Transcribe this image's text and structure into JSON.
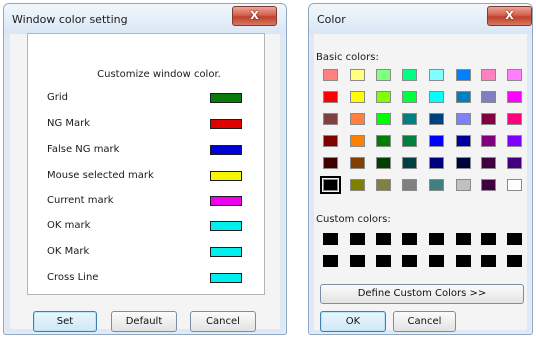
{
  "window1": {
    "title": "Window color setting",
    "close_glyph": "X",
    "heading": "Customize window color.",
    "rows": [
      {
        "label": "Grid",
        "color": "#0a7a0a"
      },
      {
        "label": "NG Mark",
        "color": "#e00000"
      },
      {
        "label": "False NG mark",
        "color": "#0000d8"
      },
      {
        "label": "Mouse selected mark",
        "color": "#f6f600"
      },
      {
        "label": "Current mark",
        "color": "#ef00ef"
      },
      {
        "label": "OK mark",
        "color": "#00f0f0"
      },
      {
        "label": "OK Mark",
        "color": "#00f0f0"
      },
      {
        "label": "Cross Line",
        "color": "#00f0f0"
      }
    ],
    "buttons": {
      "set": "Set",
      "default": "Default",
      "cancel": "Cancel"
    }
  },
  "window2": {
    "title": "Color",
    "close_glyph": "X",
    "basic_colors_label": "Basic colors:",
    "custom_colors_label": "Custom colors:",
    "basic_colors": [
      "#ff8080",
      "#ffff80",
      "#80ff80",
      "#00ff80",
      "#80ffff",
      "#0080ff",
      "#ff80c0",
      "#ff80ff",
      "#ff0000",
      "#ffff00",
      "#80ff00",
      "#00ff40",
      "#00ffff",
      "#0080c0",
      "#8080c0",
      "#ff00ff",
      "#804040",
      "#ff8040",
      "#00ff00",
      "#008080",
      "#004080",
      "#8080ff",
      "#800040",
      "#ff0080",
      "#800000",
      "#ff8000",
      "#008000",
      "#008040",
      "#0000ff",
      "#0000a0",
      "#800080",
      "#8000ff",
      "#400000",
      "#804000",
      "#004000",
      "#004040",
      "#000080",
      "#000040",
      "#400040",
      "#400080",
      "#000000",
      "#808000",
      "#808040",
      "#808080",
      "#408080",
      "#c0c0c0",
      "#400040",
      "#ffffff"
    ],
    "selected_index": 40,
    "custom_colors": [
      "#000000",
      "#000000",
      "#000000",
      "#000000",
      "#000000",
      "#000000",
      "#000000",
      "#000000",
      "#000000",
      "#000000",
      "#000000",
      "#000000",
      "#000000",
      "#000000",
      "#000000",
      "#000000"
    ],
    "define_button": "Define Custom Colors >>",
    "ok_button": "OK",
    "cancel_button": "Cancel"
  }
}
